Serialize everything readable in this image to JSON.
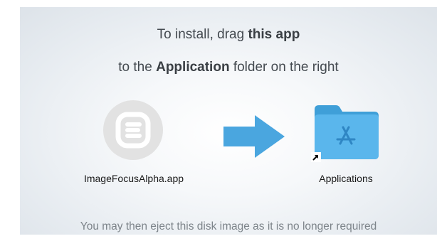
{
  "instructions": {
    "line1_prefix": "To install, drag ",
    "line1_bold": "this app",
    "line2_prefix": "to the ",
    "line2_bold": "Application",
    "line2_suffix": " folder on the right"
  },
  "items": {
    "app": {
      "label": "ImageFocusAlpha.app",
      "icon": "app-logo-icon"
    },
    "arrow": {
      "icon": "right-arrow-icon",
      "color": "#4aa6df"
    },
    "folder": {
      "label": "Applications",
      "icon": "applications-folder-icon",
      "color": "#55b3ea"
    }
  },
  "footer": {
    "text": "You may then eject this disk image as it is no longer required"
  }
}
